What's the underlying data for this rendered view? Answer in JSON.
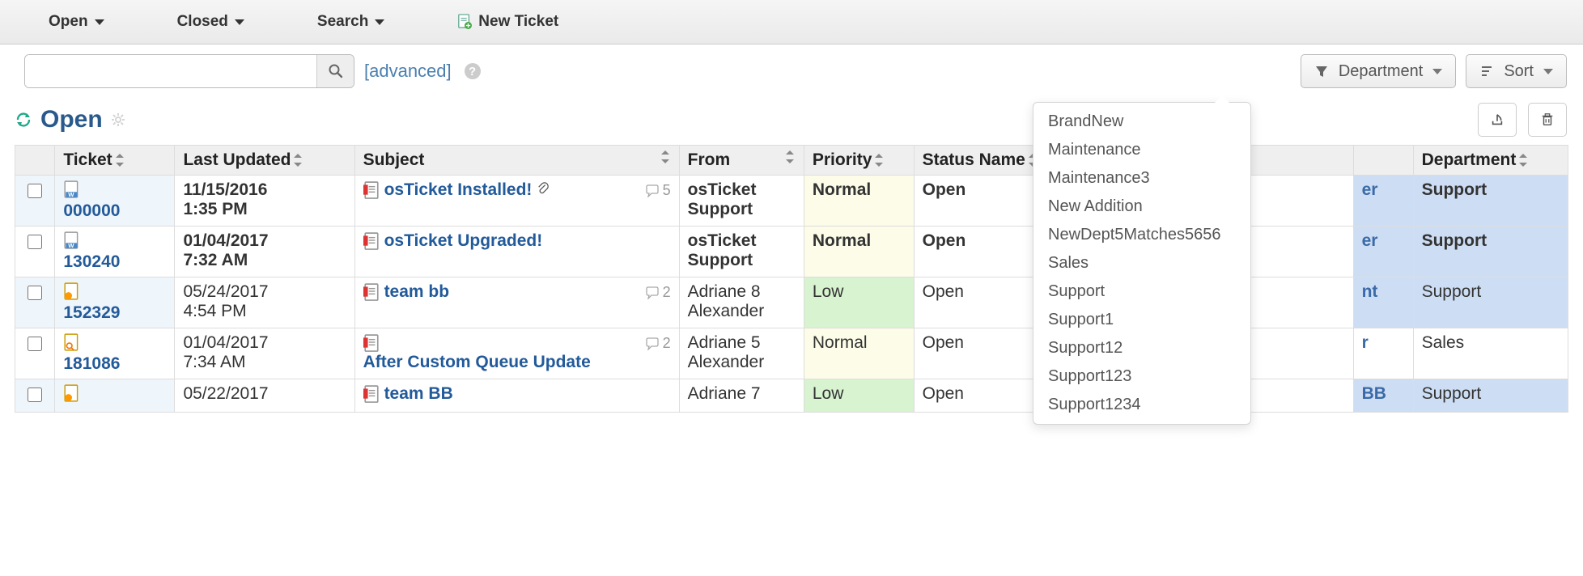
{
  "nav": {
    "open_label": "Open",
    "closed_label": "Closed",
    "search_label": "Search",
    "new_ticket_label": "New Ticket"
  },
  "search": {
    "placeholder": "",
    "advanced_label": "[advanced]"
  },
  "filters": {
    "department_label": "Department",
    "sort_label": "Sort"
  },
  "queue_title": "Open",
  "columns": {
    "ticket": "Ticket",
    "last_updated": "Last Updated",
    "subject": "Subject",
    "from": "From",
    "priority": "Priority",
    "status": "Status Name",
    "department": "Department"
  },
  "rows": [
    {
      "ticket": "000000",
      "updated_date": "11/15/2016",
      "updated_time": "1:35 PM",
      "subject": "osTicket Installed!",
      "subject_second": "",
      "has_attachment": true,
      "thread_count": "5",
      "from_1": "osTicket",
      "from_2": "Support",
      "priority": "Normal",
      "priority_class": "normal",
      "status": "Open",
      "col_right": "er",
      "department": "Support",
      "bold": true,
      "dept_hilite": "hilite"
    },
    {
      "ticket": "130240",
      "updated_date": "01/04/2017",
      "updated_time": "7:32 AM",
      "subject": "osTicket Upgraded!",
      "subject_second": "",
      "has_attachment": false,
      "thread_count": "",
      "from_1": "osTicket",
      "from_2": "Support",
      "priority": "Normal",
      "priority_class": "normal",
      "status": "Open",
      "col_right": "er",
      "department": "Support",
      "bold": true,
      "dept_hilite": "hilite"
    },
    {
      "ticket": "152329",
      "updated_date": "05/24/2017",
      "updated_time": "4:54 PM",
      "subject": "team bb",
      "subject_second": "",
      "has_attachment": false,
      "thread_count": "2",
      "from_1": "Adriane 8",
      "from_2": "Alexander",
      "priority": "Low",
      "priority_class": "low",
      "status": "Open",
      "col_right": "nt",
      "department": "Support",
      "bold": false,
      "dept_hilite": "hilite-light"
    },
    {
      "ticket": "181086",
      "updated_date": "01/04/2017",
      "updated_time": "7:34 AM",
      "subject": "",
      "subject_second": "After Custom Queue Update",
      "has_attachment": false,
      "thread_count": "2",
      "from_1": "Adriane 5",
      "from_2": "Alexander",
      "priority": "Normal",
      "priority_class": "normal",
      "status": "Open",
      "col_right": "r",
      "department": "Sales",
      "bold": false,
      "dept_hilite": ""
    },
    {
      "ticket": "",
      "updated_date": "05/22/2017",
      "updated_time": "",
      "subject": "team BB",
      "subject_second": "",
      "has_attachment": false,
      "thread_count": "",
      "from_1": "Adriane 7",
      "from_2": "",
      "priority": "Low",
      "priority_class": "low",
      "status": "Open",
      "col_right": "BB",
      "department": "Support",
      "bold": false,
      "dept_hilite": "hilite-light"
    }
  ],
  "department_menu": [
    "BrandNew",
    "Maintenance",
    "Maintenance3",
    "New Addition",
    "NewDept5Matches5656",
    "Sales",
    "Support",
    "Support1",
    "Support12",
    "Support123",
    "Support1234"
  ]
}
